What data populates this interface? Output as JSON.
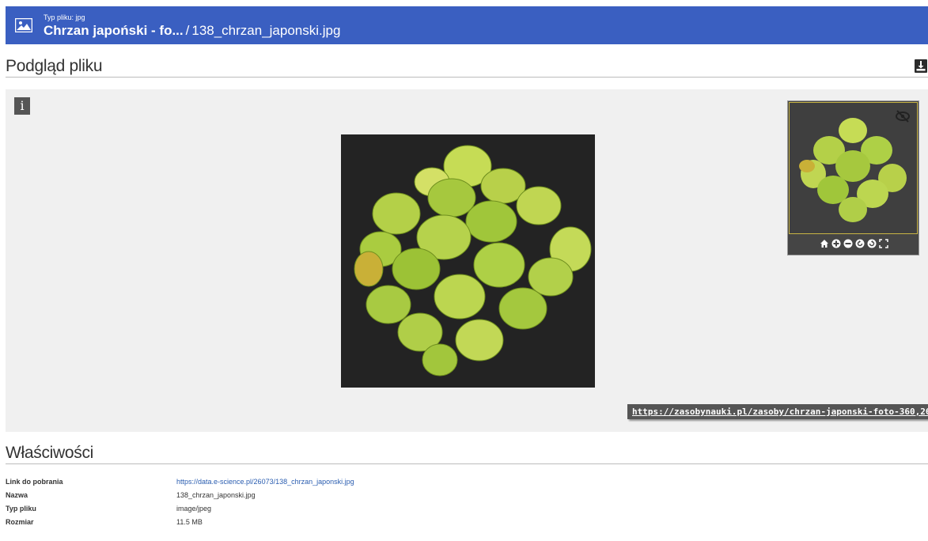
{
  "header": {
    "file_type_label": "Typ pliku: jpg",
    "parent_title": "Chrzan japoński - fo...",
    "separator": "/",
    "file_name": "138_chrzan_japonski.jpg",
    "color": "#3a5fc1"
  },
  "preview": {
    "title": "Podgląd pliku",
    "info_glyph": "i",
    "download_icon": "download-icon",
    "image_subject": "Top view of Japanese horseradish (wasabi) plant with light green leaves on dark background",
    "navigator_controls": [
      "home-icon",
      "zoom-in-icon",
      "zoom-out-icon",
      "rotate-left-icon",
      "rotate-right-icon",
      "fullscreen-icon"
    ],
    "hide_icon": "eye-slash-icon",
    "source_url": "https://zasobynauki.pl/zasoby/chrzan-japonski-foto-360,26073/"
  },
  "properties": {
    "title": "Właściwości",
    "rows": [
      {
        "label": "Link do pobrania",
        "value": "https://data.e-science.pl/26073/138_chrzan_japonski.jpg"
      },
      {
        "label": "Nazwa",
        "value": "138_chrzan_japonski.jpg"
      },
      {
        "label": "Typ pliku",
        "value": "image/jpeg"
      },
      {
        "label": "Rozmiar",
        "value": "11.5 MB"
      }
    ]
  }
}
